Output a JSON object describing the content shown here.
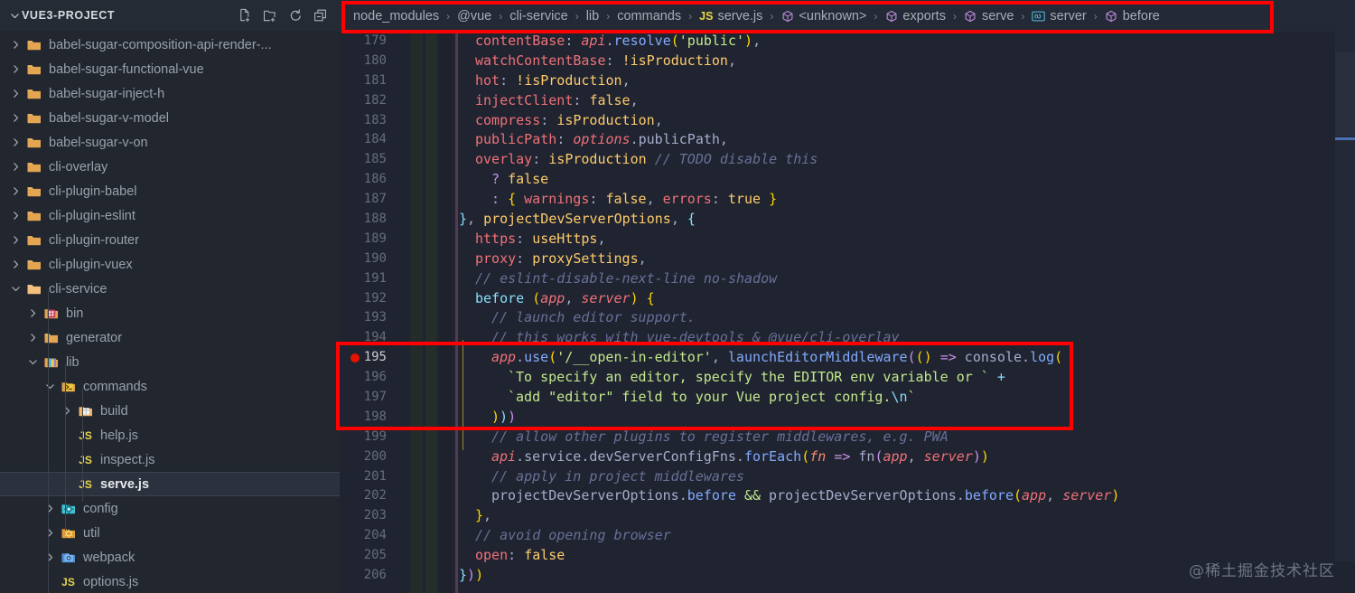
{
  "window": {
    "background": "#1f2430",
    "accent": "#ff0000"
  },
  "sidebar": {
    "header": {
      "title": "VUE3-PROJECT",
      "chevron": "chevron-down-icon",
      "actions": [
        {
          "name": "new-file-icon",
          "tooltip": "New File"
        },
        {
          "name": "new-folder-icon",
          "tooltip": "New Folder"
        },
        {
          "name": "refresh-icon",
          "tooltip": "Refresh Explorer"
        },
        {
          "name": "collapse-all-icon",
          "tooltip": "Collapse Folders in Explorer"
        }
      ]
    },
    "items": [
      {
        "label": "babel-sugar-composition-api-render-...",
        "indent": 1,
        "state": "collapsed",
        "icon": "folder-icon",
        "selected": false
      },
      {
        "label": "babel-sugar-functional-vue",
        "indent": 1,
        "state": "collapsed",
        "icon": "folder-icon",
        "selected": false
      },
      {
        "label": "babel-sugar-inject-h",
        "indent": 1,
        "state": "collapsed",
        "icon": "folder-icon",
        "selected": false
      },
      {
        "label": "babel-sugar-v-model",
        "indent": 1,
        "state": "collapsed",
        "icon": "folder-icon",
        "selected": false
      },
      {
        "label": "babel-sugar-v-on",
        "indent": 1,
        "state": "collapsed",
        "icon": "folder-icon",
        "selected": false
      },
      {
        "label": "cli-overlay",
        "indent": 1,
        "state": "collapsed",
        "icon": "folder-icon",
        "selected": false
      },
      {
        "label": "cli-plugin-babel",
        "indent": 1,
        "state": "collapsed",
        "icon": "folder-icon",
        "selected": false
      },
      {
        "label": "cli-plugin-eslint",
        "indent": 1,
        "state": "collapsed",
        "icon": "folder-icon",
        "selected": false
      },
      {
        "label": "cli-plugin-router",
        "indent": 1,
        "state": "collapsed",
        "icon": "folder-icon",
        "selected": false
      },
      {
        "label": "cli-plugin-vuex",
        "indent": 1,
        "state": "collapsed",
        "icon": "folder-icon",
        "selected": false
      },
      {
        "label": "cli-service",
        "indent": 1,
        "state": "expanded",
        "icon": "folder-open-icon",
        "selected": false
      },
      {
        "label": "bin",
        "indent": 2,
        "state": "collapsed",
        "icon": "folder-bin-icon",
        "selected": false
      },
      {
        "label": "generator",
        "indent": 2,
        "state": "collapsed",
        "icon": "folder-icon",
        "selected": false
      },
      {
        "label": "lib",
        "indent": 2,
        "state": "expanded",
        "icon": "folder-lib-icon",
        "selected": false
      },
      {
        "label": "commands",
        "indent": 3,
        "state": "expanded",
        "icon": "folder-commands-icon",
        "selected": false
      },
      {
        "label": "build",
        "indent": 4,
        "state": "collapsed",
        "icon": "folder-build-icon",
        "selected": false
      },
      {
        "label": "help.js",
        "indent": 4,
        "state": "leaf",
        "icon": "js-file-icon",
        "selected": false
      },
      {
        "label": "inspect.js",
        "indent": 4,
        "state": "leaf",
        "icon": "js-file-icon",
        "selected": false
      },
      {
        "label": "serve.js",
        "indent": 4,
        "state": "leaf",
        "icon": "js-file-icon",
        "selected": true
      },
      {
        "label": "config",
        "indent": 3,
        "state": "collapsed",
        "icon": "folder-config-icon",
        "selected": false
      },
      {
        "label": "util",
        "indent": 3,
        "state": "collapsed",
        "icon": "folder-util-icon",
        "selected": false
      },
      {
        "label": "webpack",
        "indent": 3,
        "state": "collapsed",
        "icon": "folder-webpack-icon",
        "selected": false
      },
      {
        "label": "options.js",
        "indent": 3,
        "state": "leaf",
        "icon": "js-file-icon",
        "selected": false
      }
    ]
  },
  "breadcrumb": {
    "separator": "›",
    "crumbs": [
      {
        "label": "node_modules",
        "icon": "none"
      },
      {
        "label": "@vue",
        "icon": "none"
      },
      {
        "label": "cli-service",
        "icon": "none"
      },
      {
        "label": "lib",
        "icon": "none"
      },
      {
        "label": "commands",
        "icon": "none"
      },
      {
        "label": "serve.js",
        "icon": "js-file-icon"
      },
      {
        "label": "<unknown>",
        "icon": "module-icon"
      },
      {
        "label": "exports",
        "icon": "module-icon"
      },
      {
        "label": "serve",
        "icon": "module-icon"
      },
      {
        "label": "server",
        "icon": "variable-icon"
      },
      {
        "label": "before",
        "icon": "module-icon"
      }
    ]
  },
  "editor": {
    "language": "javascript",
    "breakpoint_line": 195,
    "current_line": 195,
    "first_line": 179,
    "lines": [
      {
        "n": 179,
        "indent": 4,
        "tokens": [
          {
            "t": "contentBase",
            "c": "t-prop"
          },
          {
            "t": ": ",
            "c": "t-plain"
          },
          {
            "t": "api",
            "c": "t-obj"
          },
          {
            "t": ".",
            "c": "t-plain"
          },
          {
            "t": "resolve",
            "c": "t-fn"
          },
          {
            "t": "(",
            "c": "t-yellow"
          },
          {
            "t": "'public'",
            "c": "t-str"
          },
          {
            "t": ")",
            "c": "t-yellow"
          },
          {
            "t": ",",
            "c": "t-plain"
          }
        ]
      },
      {
        "n": 180,
        "indent": 4,
        "tokens": [
          {
            "t": "watchContentBase",
            "c": "t-prop"
          },
          {
            "t": ": ",
            "c": "t-plain"
          },
          {
            "t": "!",
            "c": "t-bang"
          },
          {
            "t": "isProduction",
            "c": "t-var"
          },
          {
            "t": ",",
            "c": "t-plain"
          }
        ]
      },
      {
        "n": 181,
        "indent": 4,
        "tokens": [
          {
            "t": "hot",
            "c": "t-prop"
          },
          {
            "t": ": ",
            "c": "t-plain"
          },
          {
            "t": "!",
            "c": "t-bang"
          },
          {
            "t": "isProduction",
            "c": "t-var"
          },
          {
            "t": ",",
            "c": "t-plain"
          }
        ]
      },
      {
        "n": 182,
        "indent": 4,
        "tokens": [
          {
            "t": "injectClient",
            "c": "t-prop"
          },
          {
            "t": ": ",
            "c": "t-plain"
          },
          {
            "t": "false",
            "c": "t-var"
          },
          {
            "t": ",",
            "c": "t-plain"
          }
        ]
      },
      {
        "n": 183,
        "indent": 4,
        "tokens": [
          {
            "t": "compress",
            "c": "t-prop"
          },
          {
            "t": ": ",
            "c": "t-plain"
          },
          {
            "t": "isProduction",
            "c": "t-var"
          },
          {
            "t": ",",
            "c": "t-plain"
          }
        ]
      },
      {
        "n": 184,
        "indent": 4,
        "tokens": [
          {
            "t": "publicPath",
            "c": "t-prop"
          },
          {
            "t": ": ",
            "c": "t-plain"
          },
          {
            "t": "options",
            "c": "t-obj"
          },
          {
            "t": ".publicPath,",
            "c": "t-plain"
          }
        ]
      },
      {
        "n": 185,
        "indent": 4,
        "tokens": [
          {
            "t": "overlay",
            "c": "t-prop"
          },
          {
            "t": ": ",
            "c": "t-plain"
          },
          {
            "t": "isProduction",
            "c": "t-var"
          },
          {
            "t": " ",
            "c": "t-plain"
          },
          {
            "t": "// TODO disable this",
            "c": "t-cmt"
          }
        ]
      },
      {
        "n": 186,
        "indent": 5,
        "tokens": [
          {
            "t": "? ",
            "c": "t-magenta"
          },
          {
            "t": "false",
            "c": "t-var"
          }
        ]
      },
      {
        "n": 187,
        "indent": 5,
        "tokens": [
          {
            "t": ": ",
            "c": "t-magenta"
          },
          {
            "t": "{",
            "c": "t-yellow"
          },
          {
            "t": " ",
            "c": "t-plain"
          },
          {
            "t": "warnings",
            "c": "t-prop"
          },
          {
            "t": ": ",
            "c": "t-plain"
          },
          {
            "t": "false",
            "c": "t-var"
          },
          {
            "t": ", ",
            "c": "t-plain"
          },
          {
            "t": "errors",
            "c": "t-prop"
          },
          {
            "t": ": ",
            "c": "t-plain"
          },
          {
            "t": "true",
            "c": "t-var"
          },
          {
            "t": " ",
            "c": "t-plain"
          },
          {
            "t": "}",
            "c": "t-yellow"
          }
        ]
      },
      {
        "n": 188,
        "indent": 3,
        "tokens": [
          {
            "t": "}",
            "c": "t-punc"
          },
          {
            "t": ", ",
            "c": "t-plain"
          },
          {
            "t": "projectDevServerOptions",
            "c": "t-var"
          },
          {
            "t": ", ",
            "c": "t-plain"
          },
          {
            "t": "{",
            "c": "t-punc"
          }
        ]
      },
      {
        "n": 189,
        "indent": 4,
        "tokens": [
          {
            "t": "https",
            "c": "t-prop"
          },
          {
            "t": ": ",
            "c": "t-plain"
          },
          {
            "t": "useHttps",
            "c": "t-var"
          },
          {
            "t": ",",
            "c": "t-plain"
          }
        ]
      },
      {
        "n": 190,
        "indent": 4,
        "tokens": [
          {
            "t": "proxy",
            "c": "t-prop"
          },
          {
            "t": ": ",
            "c": "t-plain"
          },
          {
            "t": "proxySettings",
            "c": "t-var"
          },
          {
            "t": ",",
            "c": "t-plain"
          }
        ]
      },
      {
        "n": 191,
        "indent": 4,
        "tokens": [
          {
            "t": "// eslint-disable-next-line no-shadow",
            "c": "t-cmt"
          }
        ]
      },
      {
        "n": 192,
        "indent": 4,
        "tokens": [
          {
            "t": "before ",
            "c": "t-kw"
          },
          {
            "t": "(",
            "c": "t-yellow"
          },
          {
            "t": "app",
            "c": "t-ital"
          },
          {
            "t": ", ",
            "c": "t-plain"
          },
          {
            "t": "server",
            "c": "t-ital"
          },
          {
            "t": ")",
            "c": "t-yellow"
          },
          {
            "t": " ",
            "c": "t-plain"
          },
          {
            "t": "{",
            "c": "t-yellow"
          }
        ]
      },
      {
        "n": 193,
        "indent": 5,
        "tokens": [
          {
            "t": "// launch editor support.",
            "c": "t-cmt"
          }
        ]
      },
      {
        "n": 194,
        "indent": 5,
        "tokens": [
          {
            "t": "// this works with vue-devtools & @vue/cli-overlay",
            "c": "t-cmt"
          }
        ]
      },
      {
        "n": 195,
        "indent": 5,
        "tokens": [
          {
            "t": "app",
            "c": "t-ital"
          },
          {
            "t": ".",
            "c": "t-plain"
          },
          {
            "t": "use",
            "c": "t-fn"
          },
          {
            "t": "(",
            "c": "t-yellow"
          },
          {
            "t": "'/__open-in-editor'",
            "c": "t-str"
          },
          {
            "t": ", ",
            "c": "t-plain"
          },
          {
            "t": "launchEditorMiddleware",
            "c": "t-fn"
          },
          {
            "t": "(",
            "c": "t-magenta"
          },
          {
            "t": "(",
            "c": "t-yellow"
          },
          {
            "t": ")",
            "c": "t-yellow"
          },
          {
            "t": " ",
            "c": "t-plain"
          },
          {
            "t": "=>",
            "c": "t-magenta"
          },
          {
            "t": " console.",
            "c": "t-plain"
          },
          {
            "t": "log",
            "c": "t-fn"
          },
          {
            "t": "(",
            "c": "t-yellow"
          }
        ]
      },
      {
        "n": 196,
        "indent": 6,
        "tokens": [
          {
            "t": "`To specify an editor, specify the EDITOR env variable or `",
            "c": "t-str"
          },
          {
            "t": " ",
            "c": "t-plain"
          },
          {
            "t": "+",
            "c": "t-kw"
          }
        ]
      },
      {
        "n": 197,
        "indent": 6,
        "tokens": [
          {
            "t": "`add \"editor\" field to your Vue project config.",
            "c": "t-str"
          },
          {
            "t": "\\n",
            "c": "t-esc"
          },
          {
            "t": "`",
            "c": "t-str"
          }
        ]
      },
      {
        "n": 198,
        "indent": 5,
        "tokens": [
          {
            "t": ")",
            "c": "t-yellow"
          },
          {
            "t": ")",
            "c": "t-kw"
          },
          {
            "t": ")",
            "c": "t-magenta"
          }
        ]
      },
      {
        "n": 199,
        "indent": 5,
        "tokens": [
          {
            "t": "// allow other plugins to register middlewares, e.g. PWA",
            "c": "t-cmt"
          }
        ]
      },
      {
        "n": 200,
        "indent": 5,
        "tokens": [
          {
            "t": "api",
            "c": "t-obj"
          },
          {
            "t": ".service.devServerConfigFns.",
            "c": "t-plain"
          },
          {
            "t": "forEach",
            "c": "t-fn"
          },
          {
            "t": "(",
            "c": "t-yellow"
          },
          {
            "t": "fn",
            "c": "t-param"
          },
          {
            "t": " ",
            "c": "t-plain"
          },
          {
            "t": "=>",
            "c": "t-magenta"
          },
          {
            "t": " ",
            "c": "t-plain"
          },
          {
            "t": "fn",
            "c": "t-plain"
          },
          {
            "t": "(",
            "c": "t-magenta"
          },
          {
            "t": "app",
            "c": "t-ital"
          },
          {
            "t": ", ",
            "c": "t-plain"
          },
          {
            "t": "server",
            "c": "t-ital"
          },
          {
            "t": ")",
            "c": "t-magenta"
          },
          {
            "t": ")",
            "c": "t-yellow"
          }
        ]
      },
      {
        "n": 201,
        "indent": 5,
        "tokens": [
          {
            "t": "// apply in project middlewares",
            "c": "t-cmt"
          }
        ]
      },
      {
        "n": 202,
        "indent": 5,
        "tokens": [
          {
            "t": "projectDevServerOptions",
            "c": "t-plain"
          },
          {
            "t": ".",
            "c": "t-plain"
          },
          {
            "t": "before",
            "c": "t-fn"
          },
          {
            "t": " ",
            "c": "t-plain"
          },
          {
            "t": "&&",
            "c": "t-green"
          },
          {
            "t": " projectDevServerOptions",
            "c": "t-plain"
          },
          {
            "t": ".",
            "c": "t-plain"
          },
          {
            "t": "before",
            "c": "t-fn"
          },
          {
            "t": "(",
            "c": "t-yellow"
          },
          {
            "t": "app",
            "c": "t-ital"
          },
          {
            "t": ", ",
            "c": "t-plain"
          },
          {
            "t": "server",
            "c": "t-ital"
          },
          {
            "t": ")",
            "c": "t-yellow"
          }
        ]
      },
      {
        "n": 203,
        "indent": 4,
        "tokens": [
          {
            "t": "}",
            "c": "t-yellow"
          },
          {
            "t": ",",
            "c": "t-plain"
          }
        ]
      },
      {
        "n": 204,
        "indent": 4,
        "tokens": [
          {
            "t": "// avoid opening browser",
            "c": "t-cmt"
          }
        ]
      },
      {
        "n": 205,
        "indent": 4,
        "tokens": [
          {
            "t": "open",
            "c": "t-prop"
          },
          {
            "t": ": ",
            "c": "t-plain"
          },
          {
            "t": "false",
            "c": "t-var"
          }
        ]
      },
      {
        "n": 206,
        "indent": 3,
        "tokens": [
          {
            "t": "}",
            "c": "t-punc"
          },
          {
            "t": ")",
            "c": "t-magenta"
          },
          {
            "t": ")",
            "c": "t-yellow"
          }
        ]
      }
    ]
  },
  "annotations": [
    {
      "name": "breadcrumb-highlight",
      "color": "#ff0000"
    },
    {
      "name": "code-highlight",
      "color": "#ff0000"
    }
  ],
  "watermark": {
    "text": "@稀土掘金技术社区"
  }
}
